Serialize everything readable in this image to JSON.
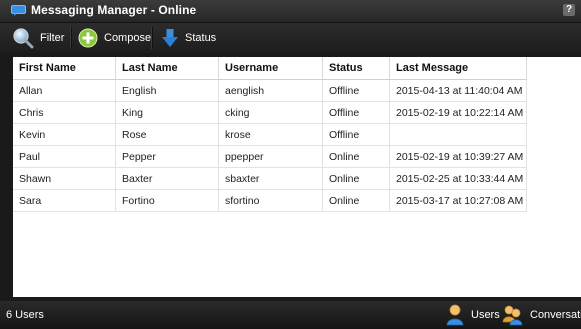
{
  "window": {
    "title": "Messaging Manager - Online",
    "help_label": "?"
  },
  "toolbar": {
    "filter_label": "Filter",
    "compose_label": "Compose",
    "status_label": "Status"
  },
  "table": {
    "columns": [
      "First Name",
      "Last Name",
      "Username",
      "Status",
      "Last Message"
    ],
    "rows": [
      [
        "Allan",
        "English",
        "aenglish",
        "Offline",
        "2015-04-13 at 11:40:04 AM"
      ],
      [
        "Chris",
        "King",
        "cking",
        "Offline",
        "2015-02-19 at 10:22:14 AM"
      ],
      [
        "Kevin",
        "Rose",
        "krose",
        "Offline",
        ""
      ],
      [
        "Paul",
        "Pepper",
        "ppepper",
        "Online",
        "2015-02-19 at 10:39:27 AM"
      ],
      [
        "Shawn",
        "Baxter",
        "sbaxter",
        "Online",
        "2015-02-25 at 10:33:44 AM"
      ],
      [
        "Sara",
        "Fortino",
        "sfortino",
        "Online",
        "2015-03-17 at 10:27:08 AM"
      ]
    ]
  },
  "statusbar": {
    "count_label": "6 Users",
    "users_tab_label": "Users",
    "conversations_tab_label": "Conversations"
  },
  "colors": {
    "chrome_dark": "#1a1a1a",
    "compose_green": "#8cc63f",
    "status_blue": "#2b7fd4",
    "grid_bg": "#ffffff"
  },
  "icons": {
    "app": "chat-bubble-icon",
    "filter": "magnifier-icon",
    "compose": "plus-circle-icon",
    "status": "down-arrow-icon",
    "users": "user-icon",
    "conversations": "users-group-icon"
  }
}
